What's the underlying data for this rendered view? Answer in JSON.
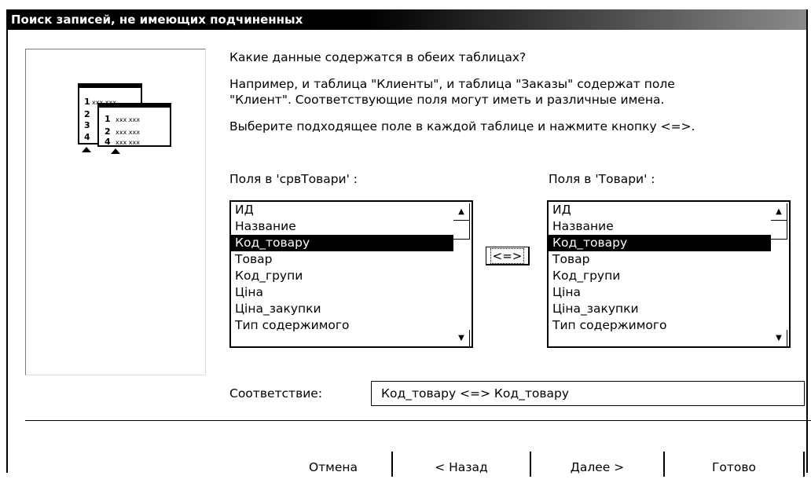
{
  "window": {
    "title": "Поиск записей, не имеющих подчиненных"
  },
  "illustration": {
    "back_rows": [
      "1",
      "2",
      "3",
      "4"
    ],
    "front_rows": [
      "1",
      "2",
      "4"
    ],
    "dummy_text": "xxx xxx"
  },
  "question": "Какие данные содержатся в обеих таблицах?",
  "example_line1": "Например, и таблица \"Клиенты\", и таблица \"Заказы\" содержат поле",
  "example_line2": "\"Клиент\". Соответствующие поля могут иметь и различные имена.",
  "instruction": "Выберите подходящее поле в каждой таблице и нажмите кнопку <=>.",
  "left_list": {
    "label": "Поля в 'срвТовари' :",
    "items": [
      "ИД",
      "Название",
      "Код_товару",
      "Товар",
      "Код_групи",
      "Ціна",
      "Ціна_закупки",
      "Тип содержимого"
    ],
    "selected": "Код_товару"
  },
  "right_list": {
    "label": "Поля в 'Товари' :",
    "items": [
      "ИД",
      "Название",
      "Код_товару",
      "Товар",
      "Код_групи",
      "Ціна",
      "Ціна_закупки",
      "Тип содержимого"
    ],
    "selected": "Код_товару"
  },
  "swap_button": "<=>",
  "match": {
    "label": "Соответствие:",
    "value": "Код_товару <=> Код_товару"
  },
  "buttons": {
    "cancel": "Отмена",
    "back": "< Назад",
    "next": "Далее >",
    "finish": "Готово"
  }
}
